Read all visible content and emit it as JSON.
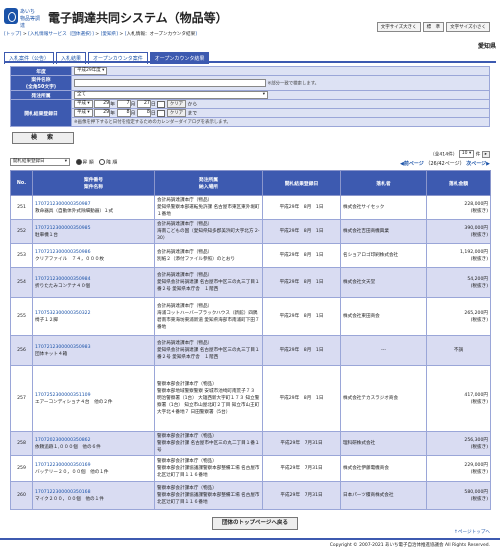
{
  "header": {
    "logo_line1": "あいち",
    "logo_line2": "物品等調達",
    "title": "電子調達共同システム（物品等）",
    "font_large": "文字サイズ大きく",
    "font_std": "標　準",
    "font_small": "文字サイズ小さく"
  },
  "breadcrumb": [
    "トップ",
    "入札情報サービス（団体選択）",
    "愛知県",
    "入札情報：オープンカウンタ結果"
  ],
  "breadcrumb_sep": " > ",
  "org": "愛知県",
  "tabs": [
    "入札案件（公告）",
    "入札結果",
    "オープンカウンタ案件",
    "オープンカウンタ結果"
  ],
  "form": {
    "year_label": "年度",
    "year_value": "平成29年度",
    "name_label": "案件名称",
    "name_sub": "(全角50文字)",
    "name_note": "※部分一致で検索します。",
    "orderer_label": "発注所属",
    "orderer_value": "全て",
    "date_label": "開札結果登録日",
    "era": "平成",
    "from_y": "29",
    "from_m": "7",
    "from_d": "27",
    "to_y": "29",
    "to_m": "8",
    "to_d": "8",
    "y": "年",
    "m": "月",
    "d": "日",
    "clear": "クリア",
    "from_word": "から",
    "to_word": "まで",
    "cal_note": "※画像を押下すると日付を指定するためのカレンダーダイアログを表示します。",
    "search_button": "検　索"
  },
  "sort": {
    "select_value": "開札結果登録日",
    "asc": "昇 順",
    "desc": "降 順"
  },
  "pager": {
    "summary": "（全414件）",
    "page_size": "10",
    "page_size_unit": "件",
    "prev": "前ページ",
    "pages": "（26/42ページ）",
    "next": "次ページ"
  },
  "columns": [
    "No.",
    "案件番号\n案件名称",
    "発注所属\n納入場所",
    "開札結果登録日",
    "落札者",
    "落札金額"
  ],
  "rows": [
    {
      "no": "251",
      "num": "1707212300000350987",
      "name": "救命器具（自動体外式除細動器）１式",
      "org": "会計局調達課本庁（物品）",
      "place": "愛知県警察本部運転免許課 名古屋市東区東外堀町１番地",
      "date": "平成29年　8月　1日",
      "winner": "株式会社サイセック",
      "amt": "228,000円",
      "tax": "(税抜き)"
    },
    {
      "no": "252",
      "num": "1707212300000350985",
      "name": "駐車機１台",
      "org": "会計局調達課本庁（物品）",
      "place": "海南こどもの国（愛知県知多郡美浜町大字北方 2-30）",
      "date": "平成29年　8月　1日",
      "winner": "株式会社吉田商機興業",
      "amt": "390,000円",
      "tax": "(税抜き)"
    },
    {
      "no": "253",
      "num": "1707212300000350986",
      "name": "クリアファイル　７４，０００枚",
      "org": "会計局調達課本庁（物品）",
      "place": "別紙２（添付ファイル参照）のとおり",
      "date": "平成29年　8月　1日",
      "winner": "名ショアロゴ印刷株式会社",
      "amt": "1,192,000円",
      "tax": "(税抜き)"
    },
    {
      "no": "254",
      "num": "1707212300000350984",
      "name": "折りたたみコンテナ４０個",
      "org": "会計局調達課本庁（物品）",
      "place": "愛知県会計局調達課 名古屋市中区三の丸三丁目１番２号 愛知県本庁舎　１階西",
      "date": "平成29年　8月　1日",
      "winner": "株式会社文天堂",
      "amt": "54,200円",
      "tax": "(税抜き)"
    },
    {
      "no": "255",
      "num": "1707532300000350322",
      "name": "椅子１２脚",
      "org": "会計局調達課本庁（物品）",
      "place": "海浦コットハーバーブラックハウス（新館）四隅　碧南市東海坊東浦新道 愛知県海部市南浦町下田７番地",
      "date": "平成29年　8月　1日",
      "winner": "株式会社東田商会",
      "amt": "265,200円",
      "tax": "(税抜き)"
    },
    {
      "no": "256",
      "num": "1707212300000350983",
      "name": "団体キット４箱",
      "org": "会計局調達課本庁（物品）",
      "place": "愛知県会計局調達課 名古屋市中区三の丸三丁目１番２号 愛知県本庁舎　１階西",
      "date": "平成29年　8月　1日",
      "winner": "---",
      "amt": "不調",
      "tax": ""
    },
    {
      "no": "257",
      "num": "1707252300000351109",
      "name": "エアーコンディショナ４台　他の２件",
      "org": "警察本部会計課本庁（物品）",
      "place": "警察本部地域警察警察 安城市池崎町南荒子７３ 明治警察署（1台） 大雄西新大字町１７３ 知立警察署（1台） 知立市山屋北町２丁目 知立市山王町大字北４番地７ 日田警察署（5台）",
      "date": "平成29年　8月　1日",
      "winner": "株式会社テカスラジオ商会",
      "amt": "417,000円",
      "tax": "(税抜き)"
    },
    {
      "no": "258",
      "num": "1707202300000350862",
      "name": "依頼追跡１,０００個　他の６件",
      "org": "警察本部会計課本庁（物品）",
      "place": "警察本部会計課 名古屋市中区三の丸二丁目１番１号",
      "date": "平成29年　7月31日",
      "winner": "理科研株式会社",
      "amt": "256,300円",
      "tax": "(税抜き)"
    },
    {
      "no": "259",
      "num": "1707122300000350169",
      "name": "バッテリー２０，００個　他の１件",
      "org": "警察本部会計課本庁（物品）",
      "place": "警察本部会計課協議課警察本部整備工場 名古屋市北区辻町了目１１６番地",
      "date": "平成29年　7月31日",
      "winner": "株式会社伊藤電機商会",
      "amt": "229,000円",
      "tax": "(税抜き)"
    },
    {
      "no": "260",
      "num": "1707122300000350168",
      "name": "マイク２００，００個　他の１件",
      "org": "警察本部会計課本庁（物品）",
      "place": "警察本部会計課協議課警察本部整備工場 名古屋市北区辻町了目１１６番地",
      "date": "平成29年　7月31日",
      "winner": "日本パーツ積商株式会社",
      "amt": "580,000円",
      "tax": "(税抜き)"
    }
  ],
  "top_button": "団体のトップページへ戻る",
  "page_top": "↑ページトップへ",
  "copyright": "Copyright © 2007-2021 あいち電子自治体推進協議会 All Rights Reserved."
}
